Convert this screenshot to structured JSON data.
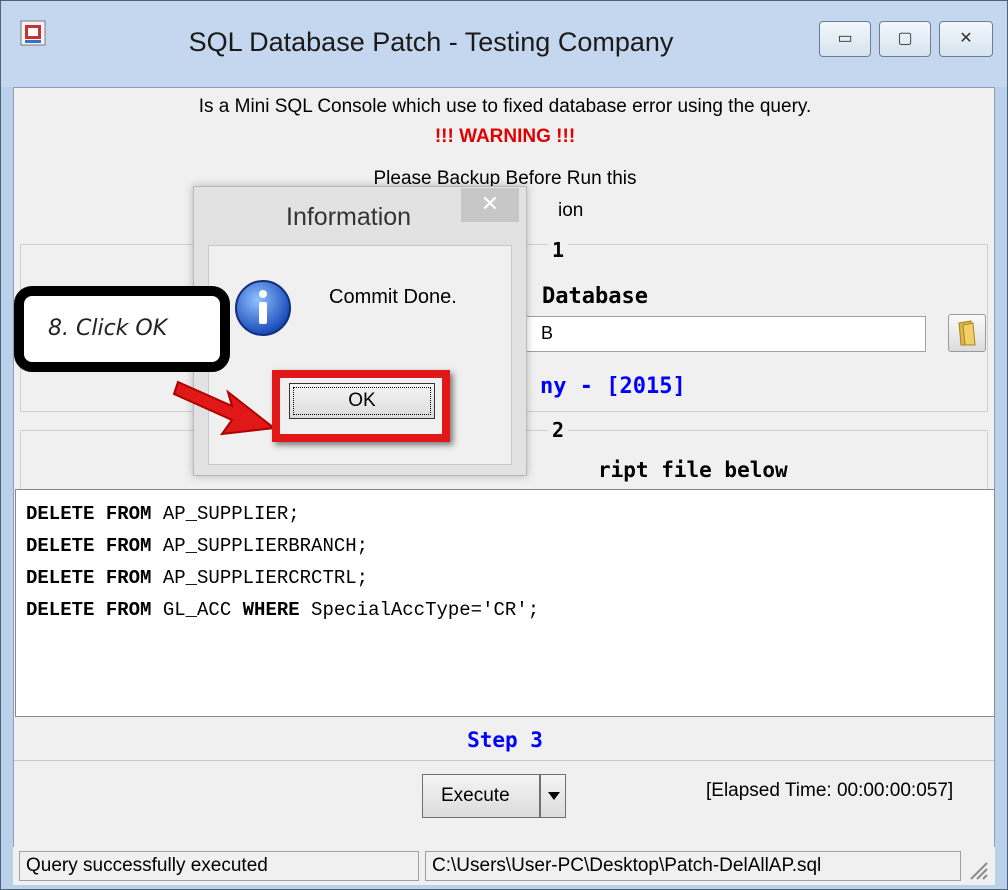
{
  "window": {
    "title": "SQL Database Patch - Testing Company",
    "minimize_glyph": "▭",
    "maximize_glyph": "▢",
    "close_glyph": "✕"
  },
  "header": {
    "description": "Is a Mini SQL Console which use to fixed database error using the query.",
    "warning": "!!! WARNING !!!",
    "note_line1": "Please Backup Before Run this",
    "note_line2": "ion"
  },
  "step1": {
    "label": "1",
    "database_label": "Database",
    "database_value": "B",
    "company_text": "ny - [2015]"
  },
  "step2": {
    "label": "2",
    "instruction": "ript file below",
    "script_lines": [
      {
        "kw1": "DELETE FROM",
        "rest": " AP_SUPPLIER;"
      },
      {
        "kw1": "DELETE FROM",
        "rest": " AP_SUPPLIERBRANCH;"
      },
      {
        "kw1": "DELETE FROM",
        "rest": " AP_SUPPLIERCRCTRL;"
      },
      {
        "kw1": "DELETE FROM",
        "rest": " GL_ACC ",
        "kw2": "WHERE",
        "rest2": " SpecialAccType='CR';"
      }
    ]
  },
  "step3": {
    "label": "Step 3",
    "execute_label": "Execute",
    "elapsed": "[Elapsed Time: 00:00:00:057]"
  },
  "statusbar": {
    "message": "Query successfully executed",
    "path": "C:\\Users\\User-PC\\Desktop\\Patch-DelAllAP.sql"
  },
  "dialog": {
    "title": "Information",
    "message": "Commit Done.",
    "ok_label": "OK",
    "close_glyph": "✕"
  },
  "annotation": {
    "callout_text": "8. Click OK"
  },
  "colors": {
    "accent_blue": "#0000ff",
    "warning_red": "#e00000",
    "highlight_red": "#e01818"
  }
}
